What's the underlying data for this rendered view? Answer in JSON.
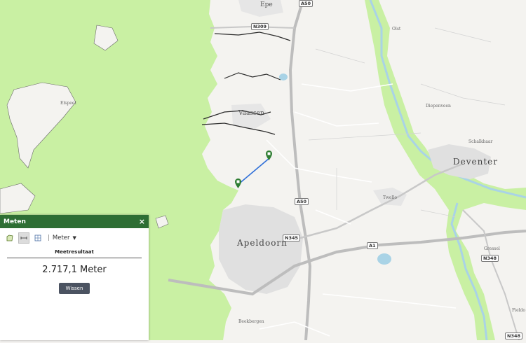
{
  "map": {
    "places": {
      "epe": "Epe",
      "olst": "Olst",
      "epse": "Diepenveen",
      "vaassen": "Vaassen",
      "elspeet": "Elspeet",
      "deventer": "Deventer",
      "schalkhaar": "Schalkhaar",
      "twello": "Twello",
      "apeldoorn": "Apeldoorn",
      "beekbergen": "Beekbergen",
      "gressel": "Gressel",
      "fieldo": "Fieldo"
    },
    "roads": {
      "a50_top": "A50",
      "n309": "N309",
      "a50_mid": "A50",
      "n345": "N345",
      "a1": "A1",
      "n348_a": "N348",
      "n348_b": "N348"
    },
    "colors": {
      "forest": "#c9f0a3",
      "land": "#f4f3f0",
      "water": "#a9d3e6",
      "urban": "#e0e0e0",
      "highway": "#bdbdbd",
      "measure_line": "#2f6fd8",
      "pin": "#2e7d32"
    }
  },
  "panel": {
    "title": "Meten",
    "close_icon": "×",
    "unit": "Meter",
    "result_label": "Meetresultaat",
    "result_value": "2.717,1 Meter",
    "clear_button": "Wissen",
    "header_color": "#2e6e34"
  }
}
